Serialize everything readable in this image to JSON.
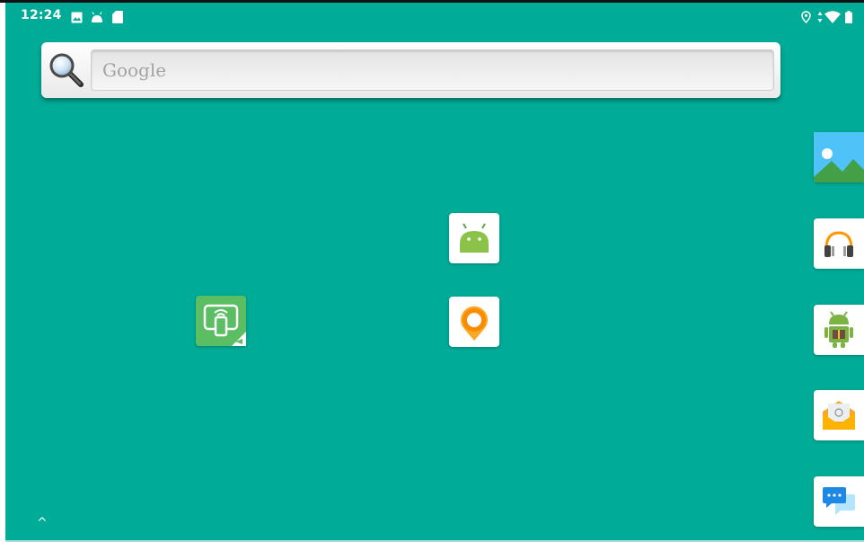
{
  "status_bar": {
    "time": "12:24",
    "left_icons": [
      "image-icon",
      "android-icon",
      "sd-card-icon"
    ],
    "right_icons": [
      "location-icon",
      "data-transfer-icon",
      "wifi-icon",
      "battery-icon"
    ]
  },
  "search_widget": {
    "placeholder": "Google",
    "icon": "magnifier-icon"
  },
  "home_apps": [
    {
      "icon": "android-icon"
    },
    {
      "icon": "screen-mirror-icon"
    },
    {
      "icon": "map-pin-icon"
    }
  ],
  "dock_apps": [
    {
      "icon": "gallery-icon"
    },
    {
      "icon": "headphones-icon"
    },
    {
      "icon": "android-gift-icon"
    },
    {
      "icon": "email-icon"
    },
    {
      "icon": "messaging-icon"
    }
  ],
  "app_drawer_caret": "^",
  "colors": {
    "wallpaper": "#00AB97",
    "android_green": "#8BC34A",
    "orange": "#FF9800",
    "blue": "#2196F3"
  }
}
